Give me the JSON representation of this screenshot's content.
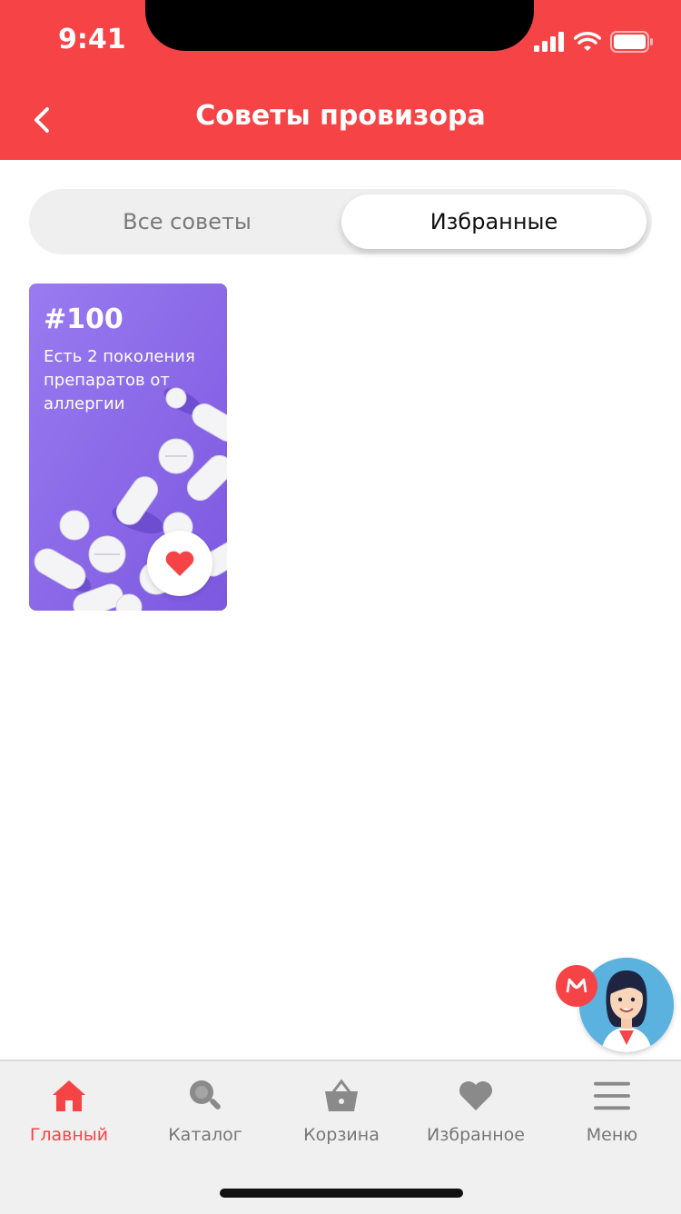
{
  "status_bar": {
    "time": "9:41"
  },
  "header": {
    "title": "Советы провизора"
  },
  "segments": {
    "all": "Все советы",
    "favorites": "Избранные"
  },
  "card": {
    "number": "#100",
    "text": "Есть 2 поколения препаратов от аллергии"
  },
  "tabbar": {
    "items": [
      {
        "label": "Главный",
        "icon": "home-icon",
        "active": true
      },
      {
        "label": "Каталог",
        "icon": "search-icon"
      },
      {
        "label": "Корзина",
        "icon": "basket-icon"
      },
      {
        "label": "Избранное",
        "icon": "heart-icon"
      },
      {
        "label": "Меню",
        "icon": "menu-icon"
      }
    ]
  },
  "colors": {
    "brand": "#F64446",
    "card_bg": "#8E6BE8",
    "inactive": "#777777"
  }
}
